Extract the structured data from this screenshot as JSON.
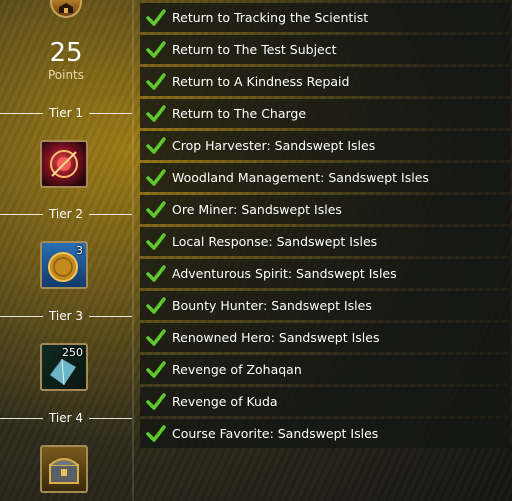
{
  "rewards": {
    "points_value": "25",
    "points_label": "Points",
    "tiers": [
      {
        "label": "Tier 1",
        "icon": "crimson-orb-icon"
      },
      {
        "label": "Tier 2",
        "icon": "gold-coin-icon",
        "count": "3"
      },
      {
        "label": "Tier 3",
        "icon": "crystal-shard-icon",
        "count": "250"
      },
      {
        "label": "Tier 4",
        "icon": "treasure-chest-icon"
      }
    ]
  },
  "achievements": [
    {
      "label": "Return to Tracking the Scientist",
      "completed": true
    },
    {
      "label": "Return to The Test Subject",
      "completed": true
    },
    {
      "label": "Return to A Kindness Repaid",
      "completed": true
    },
    {
      "label": "Return to The Charge",
      "completed": true
    },
    {
      "label": "Crop Harvester: Sandswept Isles",
      "completed": true
    },
    {
      "label": "Woodland Management: Sandswept Isles",
      "completed": true
    },
    {
      "label": "Ore Miner: Sandswept Isles",
      "completed": true
    },
    {
      "label": "Local Response: Sandswept Isles",
      "completed": true
    },
    {
      "label": "Adventurous Spirit: Sandswept Isles",
      "completed": true
    },
    {
      "label": "Bounty Hunter: Sandswept Isles",
      "completed": true
    },
    {
      "label": "Renowned Hero: Sandswept Isles",
      "completed": true
    },
    {
      "label": "Revenge of Zohaqan",
      "completed": true
    },
    {
      "label": "Revenge of Kuda",
      "completed": true
    },
    {
      "label": "Course Favorite: Sandswept Isles",
      "completed": true
    }
  ],
  "colors": {
    "check": "#5fc92a",
    "row_bg": "#141614",
    "accent": "#b5901d"
  }
}
